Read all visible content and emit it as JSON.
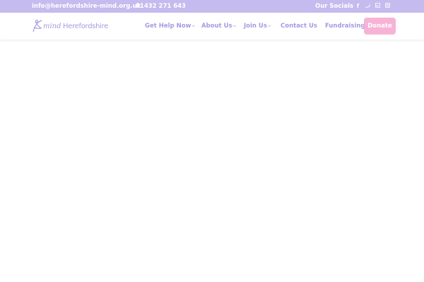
{
  "topbar": {
    "email": "info@herefordshire-mind.org.uk",
    "phone": "01432 271 643",
    "socials_label": "Our Socials",
    "social_icons": [
      "facebook-icon",
      "twitter-icon",
      "linkedin-icon",
      "instagram-icon"
    ]
  },
  "header": {
    "logo_mind": "mind",
    "logo_org": "Herefordshire",
    "nav": [
      {
        "label": "Get Help Now",
        "dropdown": true
      },
      {
        "label": "About Us",
        "dropdown": true
      },
      {
        "label": "Join Us",
        "dropdown": true
      },
      {
        "label": "Contact Us",
        "dropdown": false
      },
      {
        "label": "Fundraising",
        "dropdown": false
      }
    ],
    "donate_label": "Donate"
  },
  "colors": {
    "topbar_bg": "#c5bbee",
    "brand_purple": "#a79ae2",
    "donate_pink": "#f7b3d6"
  }
}
